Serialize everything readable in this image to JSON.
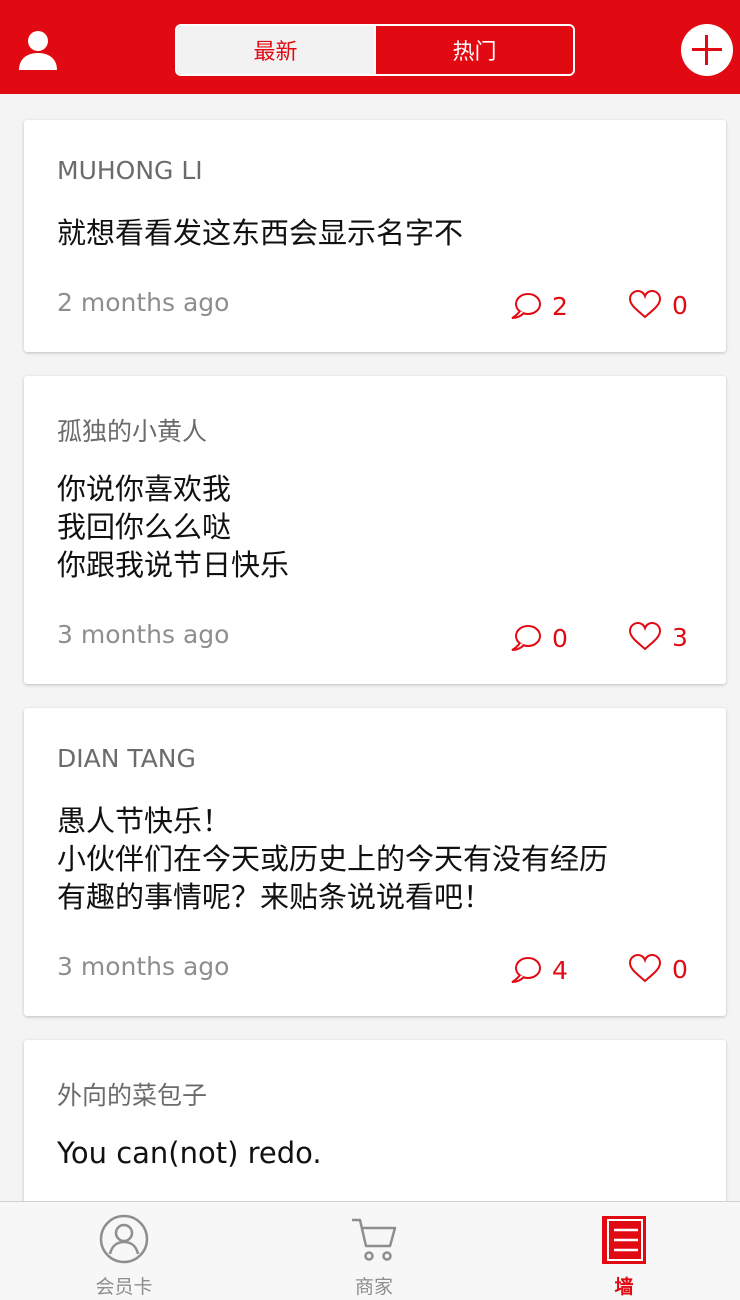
{
  "header": {
    "tabs": [
      {
        "label": "最新",
        "active": true
      },
      {
        "label": "热门",
        "active": false
      }
    ],
    "profile_icon": "user-silhouette-icon",
    "add_icon": "plus-circle-icon"
  },
  "posts": [
    {
      "author": "MUHONG LI",
      "content": "就想看看发这东西会显示名字不",
      "time": "2 months ago",
      "comments": "2",
      "likes": "0"
    },
    {
      "author": "孤独的小黄人",
      "content": "你说你喜欢我\n我回你么么哒\n你跟我说节日快乐",
      "time": "3 months ago",
      "comments": "0",
      "likes": "3"
    },
    {
      "author": "DIAN TANG",
      "content": "愚人节快乐！\n小伙伴们在今天或历史上的今天有没有经历\n有趣的事情呢？来贴条说说看吧！",
      "time": "3 months ago",
      "comments": "4",
      "likes": "0"
    },
    {
      "author": "外向的菜包子",
      "content": "You can(not) redo.",
      "time": "",
      "comments": "",
      "likes": ""
    }
  ],
  "tabbar": {
    "items": [
      {
        "label": "会员卡",
        "icon": "member-card-icon",
        "active": false
      },
      {
        "label": "商家",
        "icon": "cart-icon",
        "active": false
      },
      {
        "label": "墙",
        "icon": "wall-icon",
        "active": true
      }
    ]
  },
  "colors": {
    "brand": "#e20a12",
    "text": "#111111",
    "muted": "#8e8e8e"
  }
}
